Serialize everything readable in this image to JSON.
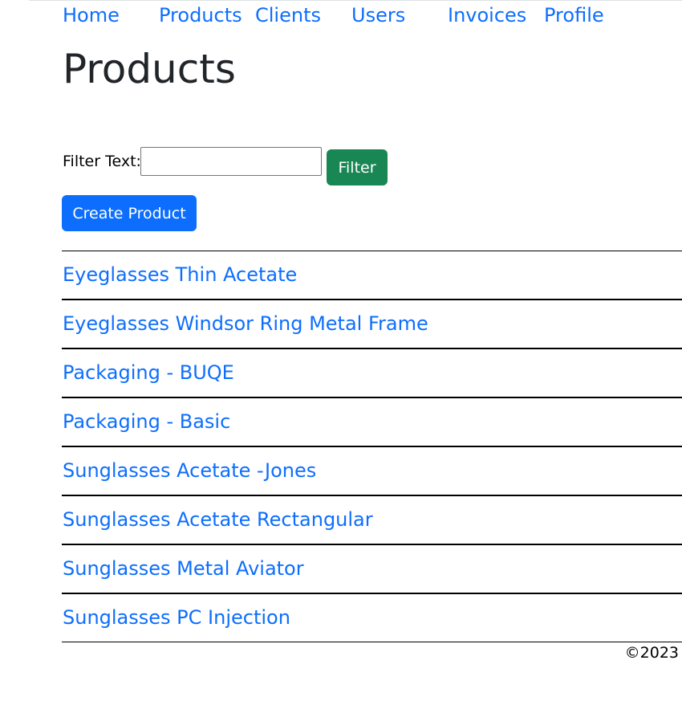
{
  "nav": {
    "items": [
      {
        "label": "Home"
      },
      {
        "label": "Products"
      },
      {
        "label": "Clients"
      },
      {
        "label": "Users"
      },
      {
        "label": "Invoices"
      },
      {
        "label": "Profile"
      }
    ]
  },
  "page": {
    "title": "Products"
  },
  "filter": {
    "label": "Filter Text:",
    "value": "",
    "button_label": "Filter"
  },
  "create_button_label": "Create Product",
  "products": [
    {
      "name": "Eyeglasses Thin Acetate"
    },
    {
      "name": "Eyeglasses Windsor Ring Metal Frame"
    },
    {
      "name": "Packaging - BUQE"
    },
    {
      "name": "Packaging - Basic"
    },
    {
      "name": "Sunglasses Acetate -Jones"
    },
    {
      "name": "Sunglasses Acetate Rectangular"
    },
    {
      "name": "Sunglasses Metal Aviator"
    },
    {
      "name": "Sunglasses PC Injection"
    }
  ],
  "footer": {
    "copyright": "©2023"
  },
  "colors": {
    "link": "#0d6efd",
    "primary_button": "#0d6efd",
    "success_button": "#198754"
  }
}
